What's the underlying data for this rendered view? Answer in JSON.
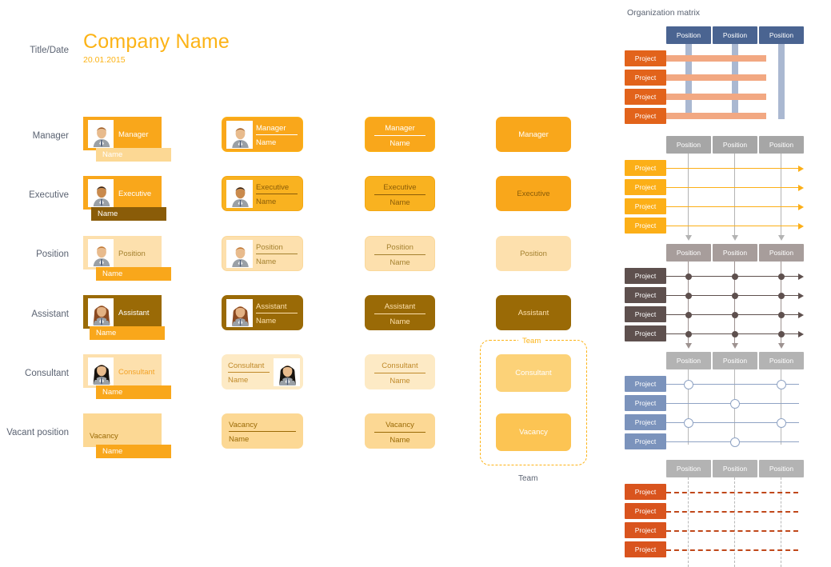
{
  "header": {
    "side_label": "Title/Date",
    "company_name": "Company Name",
    "date": "20.01.2015"
  },
  "row_labels": [
    {
      "label": "Manager"
    },
    {
      "label": "Executive"
    },
    {
      "label": "Position"
    },
    {
      "label": "Assistant"
    },
    {
      "label": "Consultant"
    },
    {
      "label": "Vacant position"
    }
  ],
  "name_placeholder": "Name",
  "roles": [
    {
      "key": "manager",
      "title": "Manager",
      "card_bg": "#f9a71b",
      "title_color": "#ffffff",
      "name_bg": "#fcd894",
      "name_color": "#ffffff",
      "rounded_bg": "#f9a71b",
      "rounded_border": "#fcb316",
      "rounded_text": "#ffffff",
      "divider": "#ffffff",
      "plain_bg": "#f9a71b",
      "plain_text": "#ffffff",
      "photo": "man-brown-hair"
    },
    {
      "key": "executive",
      "title": "Executive",
      "card_bg": "#f9a71b",
      "title_color": "#ffffff",
      "name_bg": "#8a5c08",
      "name_color": "#ffffff",
      "rounded_bg": "#f9b220",
      "rounded_border": "#f3a712",
      "rounded_text": "#8a5c08",
      "divider": "#8a5c08",
      "plain_bg": "#f9a71b",
      "plain_text": "#8a5c08",
      "photo": "man-dark-hair"
    },
    {
      "key": "position",
      "title": "Position",
      "card_bg": "#fde0ad",
      "title_color": "#a4812f",
      "name_bg": "#f9a71b",
      "name_color": "#ffffff",
      "rounded_bg": "#fde0ad",
      "rounded_border": "#fad89b",
      "rounded_text": "#a4812f",
      "divider": "#a4812f",
      "plain_bg": "#fde0ad",
      "plain_text": "#a4812f",
      "photo": "woman-dark-bob"
    },
    {
      "key": "assistant",
      "title": "Assistant",
      "card_bg": "#9a6a06",
      "title_color": "#ffffff",
      "name_bg": "#f9a71b",
      "name_color": "#ffffff",
      "rounded_bg": "#9a6a06",
      "rounded_border": "#9a6a06",
      "rounded_text": "#fde0ad",
      "divider": "#fde0ad",
      "plain_bg": "#9a6a06",
      "plain_text": "#fde0ad",
      "photo": "woman-red-hair"
    },
    {
      "key": "consultant",
      "title": "Consultant",
      "card_bg": "#fde0ad",
      "title_color": "#f2a227",
      "name_bg": "#f9a71b",
      "name_color": "#ffffff",
      "rounded_bg": "#fdeac5",
      "rounded_border": "#fdeac5",
      "rounded_text": "#c08a2a",
      "divider": "#c08a2a",
      "plain_bg": "#fcd278",
      "plain_text": "#ffffff",
      "photo": "woman-black-bob"
    },
    {
      "key": "vacancy",
      "title": "Vacancy",
      "card_bg": "#fcd894",
      "title_color": "#9a6a06",
      "name_bg": "#f9a71b",
      "name_color": "#ffffff",
      "rounded_bg": "#fcd894",
      "rounded_border": "#fcd894",
      "rounded_text": "#9a6a06",
      "divider": "#9a6a06",
      "plain_bg": "#fcc453",
      "plain_text": "#ffffff",
      "photo": "none"
    }
  ],
  "team": {
    "tag_label": "Team",
    "caption": "Team",
    "border_color": "#fcb316",
    "members": [
      "Consultant",
      "Vacancy"
    ]
  },
  "matrix_section": {
    "title": "Organization matrix",
    "position_label": "Position",
    "project_label": "Project",
    "position_count": 3,
    "project_count": 4
  },
  "chart_data": {
    "type": "table",
    "title": "Organization matrix",
    "matrices": [
      {
        "id": "matrix-1",
        "style": "thick-bands",
        "position_color": "#4a6491",
        "project_color": "#e2631b",
        "row_line_color": "#f2a882",
        "col_line_color": "#aab8d1",
        "columns": [
          "Position",
          "Position",
          "Position"
        ],
        "rows": [
          "Project",
          "Project",
          "Project",
          "Project"
        ],
        "marks": [
          [
            0,
            0,
            0
          ],
          [
            0,
            0,
            0
          ],
          [
            0,
            0,
            0
          ],
          [
            0,
            0,
            0
          ]
        ]
      },
      {
        "id": "matrix-2",
        "style": "arrows",
        "position_color": "#a6a6a6",
        "project_color": "#fcaf17",
        "row_line_color": "#fcaf17",
        "col_line_color": "#b3b3b3",
        "columns": [
          "Position",
          "Position",
          "Position"
        ],
        "rows": [
          "Project",
          "Project",
          "Project",
          "Project"
        ],
        "marks": [
          [
            0,
            0,
            0
          ],
          [
            0,
            0,
            0
          ],
          [
            0,
            0,
            0
          ],
          [
            0,
            0,
            0
          ]
        ]
      },
      {
        "id": "matrix-3",
        "style": "dots",
        "position_color": "#a79d9b",
        "project_color": "#5e504e",
        "row_line_color": "#5e504e",
        "col_line_color": "#9d9290",
        "columns": [
          "Position",
          "Position",
          "Position"
        ],
        "rows": [
          "Project",
          "Project",
          "Project",
          "Project"
        ],
        "marks": [
          [
            1,
            1,
            1
          ],
          [
            1,
            1,
            1
          ],
          [
            1,
            1,
            1
          ],
          [
            1,
            1,
            1
          ]
        ]
      },
      {
        "id": "matrix-4",
        "style": "rings",
        "position_color": "#b3b3b3",
        "project_color": "#7b93bc",
        "row_line_color": "#8fa3c4",
        "col_line_color": "#b8b8b8",
        "columns": [
          "Position",
          "Position",
          "Position"
        ],
        "rows": [
          "Project",
          "Project",
          "Project",
          "Project"
        ],
        "marks": [
          [
            1,
            0,
            1
          ],
          [
            0,
            1,
            0
          ],
          [
            1,
            0,
            1
          ],
          [
            0,
            1,
            0
          ]
        ]
      },
      {
        "id": "matrix-5",
        "style": "dashed",
        "position_color": "#b3b3b3",
        "project_color": "#d9541e",
        "row_line_color": "#c0471a",
        "col_line_color": "#b8b8b8",
        "columns": [
          "Position",
          "Position",
          "Position"
        ],
        "rows": [
          "Project",
          "Project",
          "Project",
          "Project"
        ],
        "marks": [
          [
            0,
            0,
            0
          ],
          [
            0,
            0,
            0
          ],
          [
            0,
            0,
            0
          ],
          [
            0,
            0,
            0
          ]
        ]
      }
    ]
  }
}
